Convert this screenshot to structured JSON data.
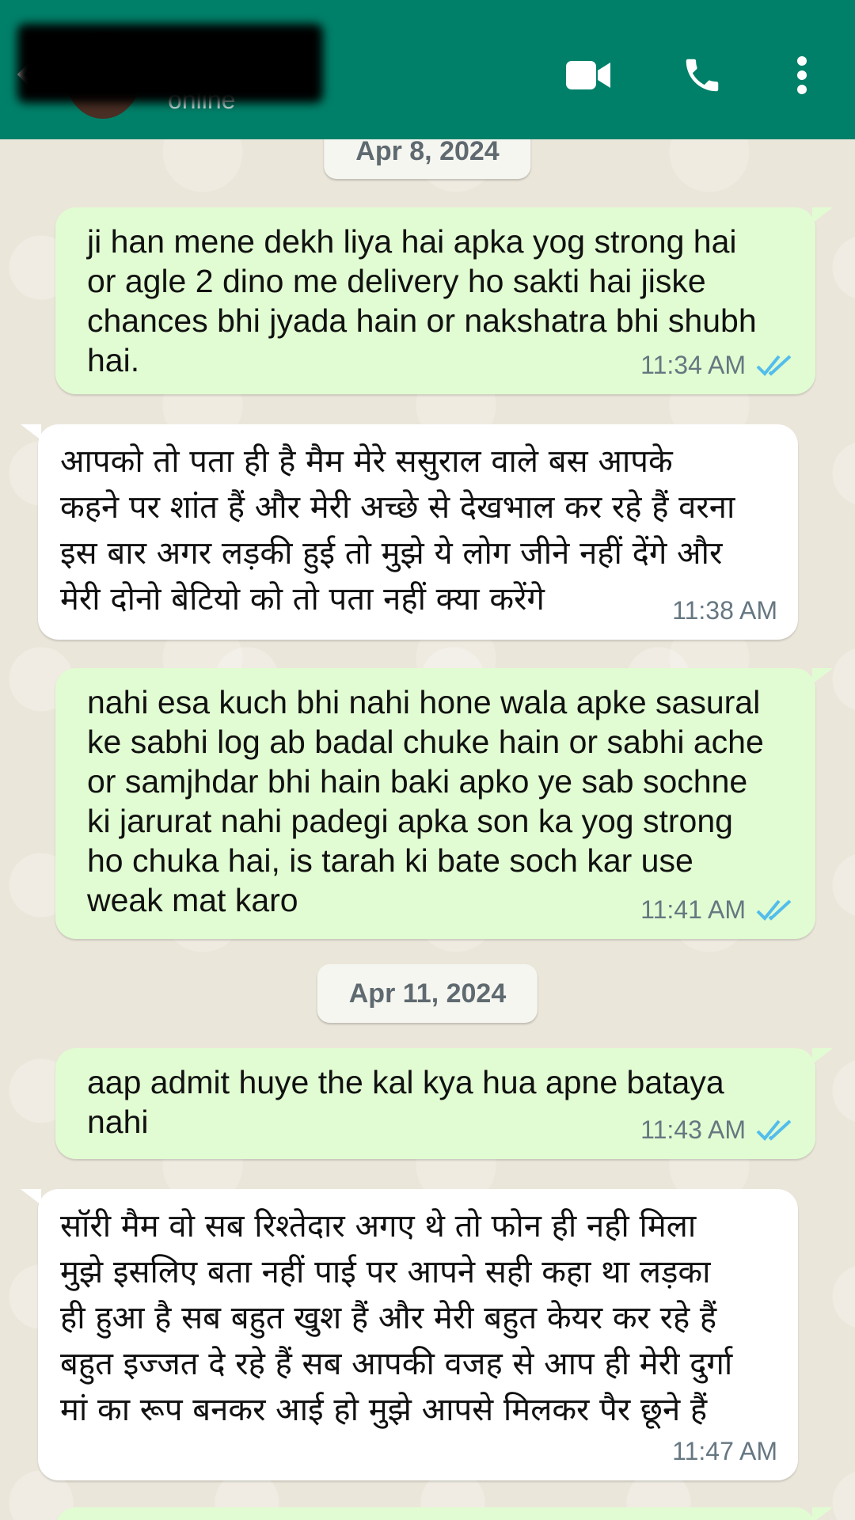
{
  "header": {
    "contact_status": "online",
    "colors": {
      "bar": "#008069",
      "tick": "#53bdeb"
    }
  },
  "messages": [
    {
      "type": "date",
      "text": "Apr 8, 2024"
    },
    {
      "type": "out",
      "text": "ji han mene dekh liya hai apka yog strong hai\nor agle 2 dino me delivery ho sakti hai jiske\nchances bhi jyada hain or nakshatra bhi shubh\nhai.",
      "time": "11:34 AM",
      "read": true
    },
    {
      "type": "in",
      "text": "आपको तो पता ही है मैम मेरे ससुराल वाले बस आपके\nकहने पर शांत हैं और मेरी अच्छे से देखभाल कर रहे हैं वरना\nइस बार अगर लड़की हुई तो मुझे ये लोग जीने नहीं देंगे और\nमेरी दोनो बेटियो को तो पता नहीं क्या करेंगे",
      "time": "11:38 AM"
    },
    {
      "type": "out",
      "text": "nahi esa kuch bhi nahi hone wala apke sasural\nke sabhi log ab badal chuke hain or sabhi ache\nor samjhdar bhi hain baki apko ye sab sochne\nki jarurat nahi padegi apka son ka yog strong\nho chuka hai, is tarah ki bate soch kar use\nweak mat karo",
      "time": "11:41 AM",
      "read": true
    },
    {
      "type": "date",
      "text": "Apr 11, 2024"
    },
    {
      "type": "out",
      "text": "aap admit huye the kal kya hua apne bataya\nnahi",
      "time": "11:43 AM",
      "read": true
    },
    {
      "type": "in",
      "text": "सॉरी मैम वो सब रिश्तेदार अगए थे तो फोन ही नही मिला\nमुझे इसलिए बता नहीं पाई पर आपने सही कहा था लड़का\nही हुआ है सब बहुत खुश हैं और मेरी बहुत केयर कर रहे हैं\nबहुत इज्जत दे रहे हैं सब आपकी वजह से आप ही मेरी दुर्गा\nमां का रूप बनकर आई हो मुझे आपसे मिलकर पैर छूने हैं",
      "time": "11:47 AM"
    }
  ]
}
